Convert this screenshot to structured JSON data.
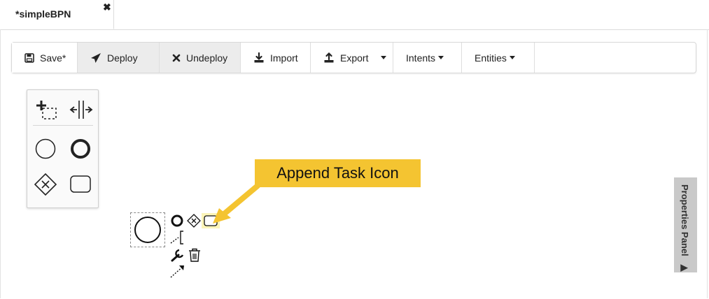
{
  "tab": {
    "title": "*simpleBPN",
    "close": "✖"
  },
  "toolbar": {
    "save": "Save*",
    "deploy": "Deploy",
    "undeploy": "Undeploy",
    "import": "Import",
    "export": "Export",
    "intents": "Intents",
    "entities": "Entities"
  },
  "palette": {
    "items": [
      "lasso-tool",
      "space-tool",
      "start-event",
      "end-event",
      "gateway",
      "task"
    ]
  },
  "callout": {
    "text": "Append Task Icon",
    "color": "#f4c431"
  },
  "properties_panel": {
    "label": "Properties Panel"
  },
  "colors": {
    "toolbar_active": "#ececec",
    "highlight": "#f4c431",
    "panel_toggle": "#c9c9c9"
  }
}
